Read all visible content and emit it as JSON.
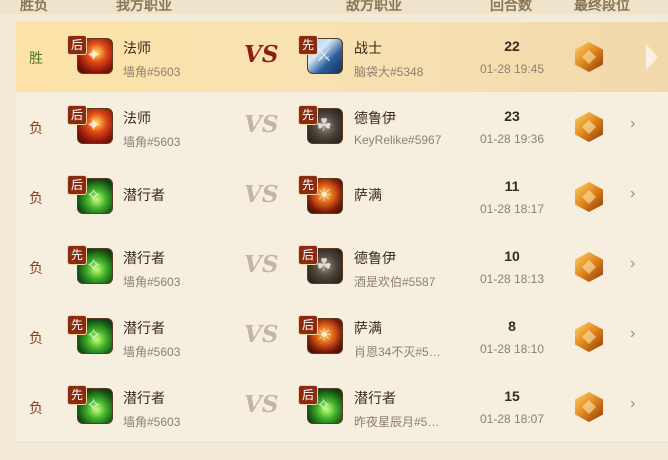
{
  "headers": {
    "result": "胜负",
    "my_class": "我方职业",
    "enemy_class": "敌方职业",
    "rounds": "回合数",
    "final_rank": "最终段位"
  },
  "vs_label": "VS",
  "matches": [
    {
      "result": "胜",
      "outcome": "win",
      "my_order": "后",
      "my_class": "法师",
      "my_icon": "mage-icon",
      "my_name": "墙角#5603",
      "enemy_order": "先",
      "enemy_class": "战士",
      "enemy_icon": "warrior-icon",
      "enemy_name": "脑袋大#5348",
      "rounds": "22",
      "time": "01-28 19:45"
    },
    {
      "result": "负",
      "outcome": "loss",
      "my_order": "后",
      "my_class": "法师",
      "my_icon": "mage-icon",
      "my_name": "墙角#5603",
      "enemy_order": "先",
      "enemy_class": "德鲁伊",
      "enemy_icon": "druid-icon",
      "enemy_name": "KeyRelike#5967",
      "rounds": "23",
      "time": "01-28 19:36"
    },
    {
      "result": "负",
      "outcome": "loss",
      "my_order": "后",
      "my_class": "潜行者",
      "my_icon": "rogue-icon",
      "my_name": "",
      "enemy_order": "先",
      "enemy_class": "萨满",
      "enemy_icon": "shaman-icon",
      "enemy_name": "",
      "rounds": "11",
      "time": "01-28 18:17"
    },
    {
      "result": "负",
      "outcome": "loss",
      "my_order": "先",
      "my_class": "潜行者",
      "my_icon": "rogue-icon",
      "my_name": "墙角#5603",
      "enemy_order": "后",
      "enemy_class": "德鲁伊",
      "enemy_icon": "druid-icon",
      "enemy_name": "酒是欢伯#5587",
      "rounds": "10",
      "time": "01-28 18:13"
    },
    {
      "result": "负",
      "outcome": "loss",
      "my_order": "先",
      "my_class": "潜行者",
      "my_icon": "rogue-icon",
      "my_name": "墙角#5603",
      "enemy_order": "后",
      "enemy_class": "萨满",
      "enemy_icon": "shaman-icon",
      "enemy_name": "肖恩34不灭#5…",
      "rounds": "8",
      "time": "01-28 18:10"
    },
    {
      "result": "负",
      "outcome": "loss",
      "my_order": "先",
      "my_class": "潜行者",
      "my_icon": "rogue-icon",
      "my_name": "墙角#5603",
      "enemy_order": "后",
      "enemy_class": "潜行者",
      "enemy_icon": "rogue-icon",
      "enemy_name": "昨夜星辰月#5…",
      "rounds": "15",
      "time": "01-28 18:07"
    }
  ]
}
